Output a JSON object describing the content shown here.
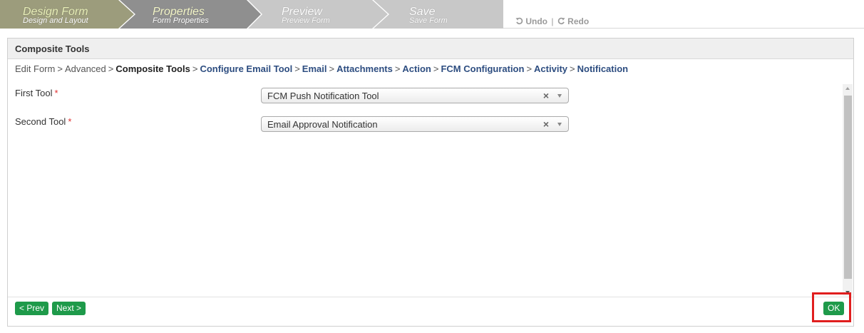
{
  "wizard": {
    "steps": [
      {
        "title": "Design Form",
        "subtitle": "Design and Layout"
      },
      {
        "title": "Properties",
        "subtitle": "Form Properties"
      },
      {
        "title": "Preview",
        "subtitle": "Preview Form"
      },
      {
        "title": "Save",
        "subtitle": "Save Form"
      }
    ],
    "undo_label": "Undo",
    "separator": "|",
    "redo_label": "Redo",
    "colors": {
      "step_first": "#9c9c7c",
      "step_active": "#8f8f8f",
      "step_inactive": "#c8c8c8"
    }
  },
  "panel": {
    "title": "Composite Tools",
    "breadcrumb": [
      {
        "label": "Edit Form"
      },
      {
        "label": "Advanced"
      },
      {
        "label": "Composite Tools"
      },
      {
        "label": "Configure Email Tool"
      },
      {
        "label": "Email"
      },
      {
        "label": "Attachments"
      },
      {
        "label": "Action"
      },
      {
        "label": "FCM Configuration"
      },
      {
        "label": "Activity"
      },
      {
        "label": "Notification"
      }
    ],
    "breadcrumb_separator": ">",
    "fields": [
      {
        "label": "First Tool",
        "required_mark": "*",
        "value": "FCM Push Notification Tool",
        "clear": "×"
      },
      {
        "label": "Second Tool",
        "required_mark": "*",
        "value": "Email Approval Notification",
        "clear": "×"
      }
    ]
  },
  "footer": {
    "prev_label": "< Prev",
    "next_label": "Next >",
    "ok_label": "OK"
  },
  "colors": {
    "button_green": "#1e9a4a",
    "link_blue": "#2d4d80",
    "highlight_red": "#e01e1e"
  }
}
